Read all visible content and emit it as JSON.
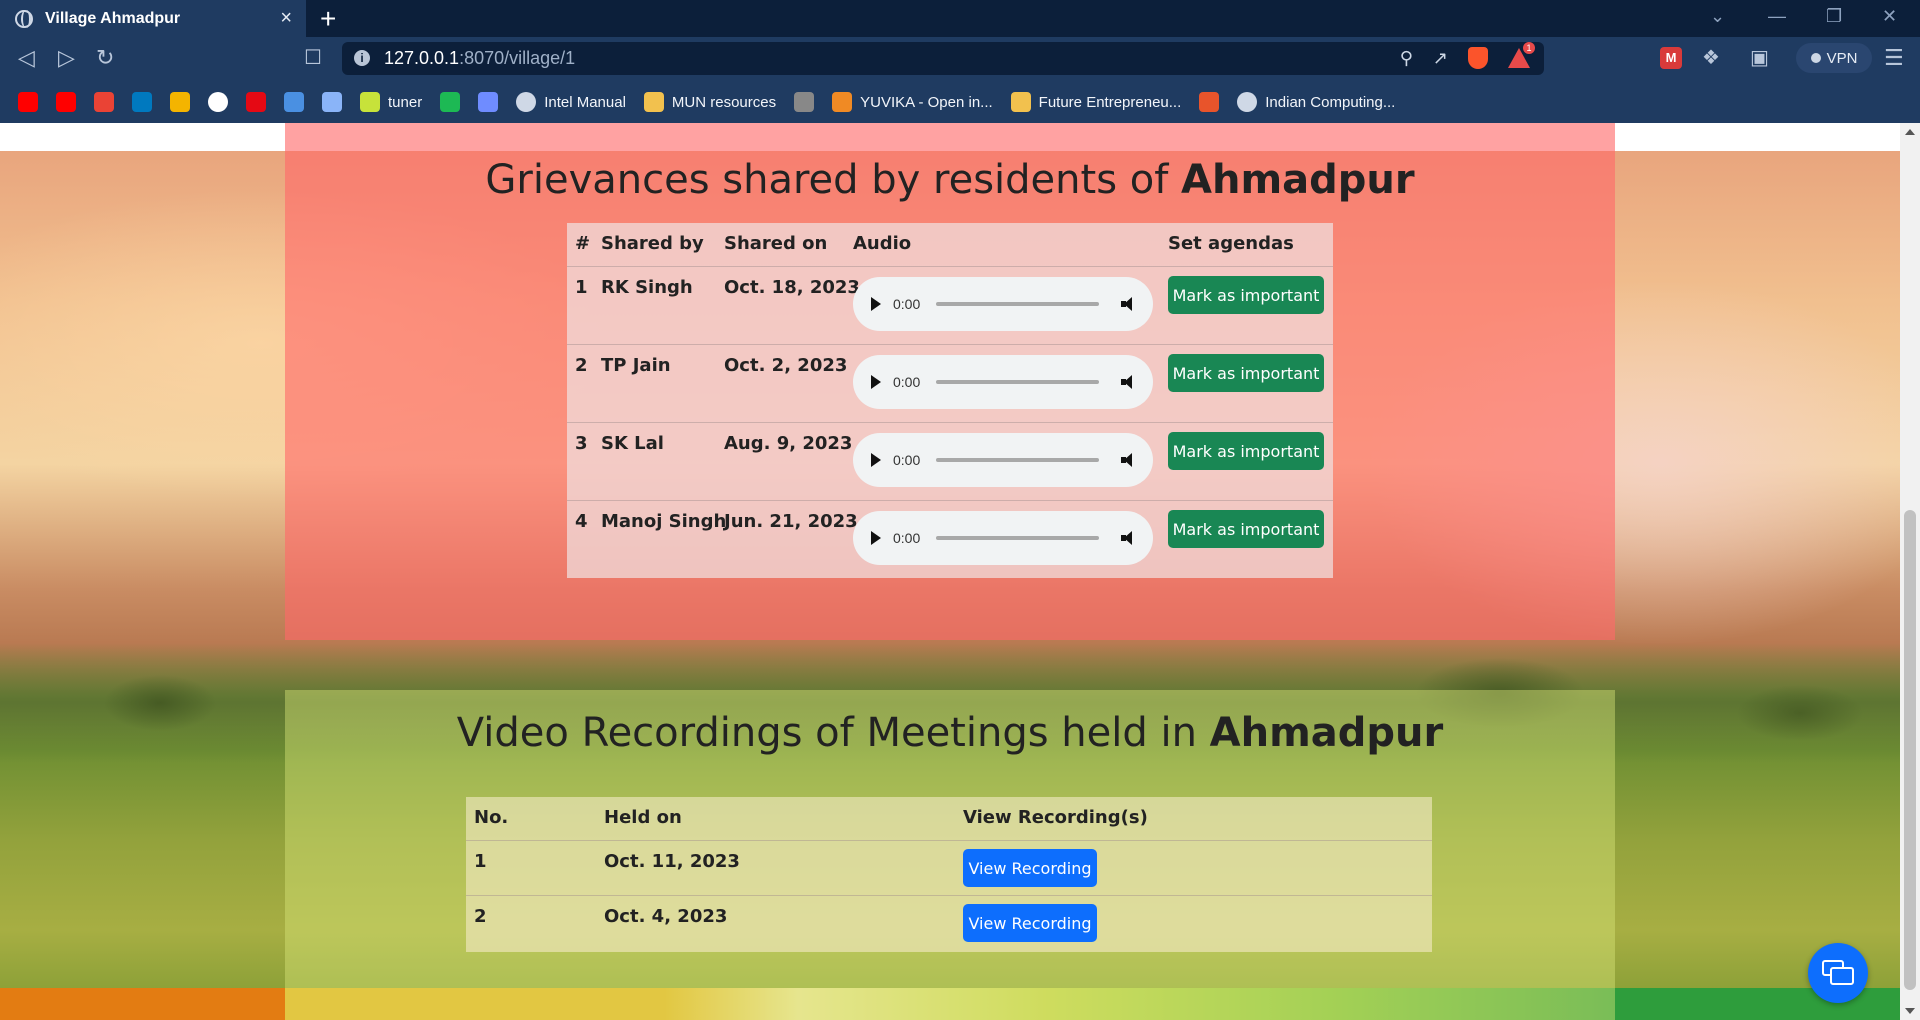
{
  "browser": {
    "tab_title": "Village Ahmadpur",
    "tab_close": "×",
    "new_tab": "+",
    "url_host": "127.0.0.1",
    "url_path": ":8070/village/1",
    "brave_badge": "1",
    "vpn_label": "VPN",
    "bookmarks": [
      {
        "label": "",
        "icon": "youtube-icon",
        "color": "#ff0000"
      },
      {
        "label": "",
        "icon": "youtube-music-icon",
        "color": "#ff0000"
      },
      {
        "label": "",
        "icon": "gmail-icon",
        "color": "#ea4335"
      },
      {
        "label": "",
        "icon": "trello-icon",
        "color": "#0079bf"
      },
      {
        "label": "",
        "icon": "photos-icon",
        "color": "#f4b400"
      },
      {
        "label": "",
        "icon": "github-icon",
        "color": "#ffffff"
      },
      {
        "label": "",
        "icon": "netflix-icon",
        "color": "#e50914"
      },
      {
        "label": "",
        "icon": "course-icon",
        "color": "#4a90e2"
      },
      {
        "label": "",
        "icon": "sparkle-icon",
        "color": "#8ab4f8"
      },
      {
        "label": "tuner",
        "icon": "tuner-icon",
        "color": "#c7e23a"
      },
      {
        "label": "",
        "icon": "spotify-icon",
        "color": "#1db954"
      },
      {
        "label": "",
        "icon": "calendar-icon",
        "color": "#6f8cff"
      },
      {
        "label": "Intel Manual",
        "icon": "globe-icon",
        "color": "#cfd8e6"
      },
      {
        "label": "MUN resources",
        "icon": "folder-icon",
        "color": "#f2c14e"
      },
      {
        "label": "",
        "icon": "dots-icon",
        "color": "#888888"
      },
      {
        "label": "YUVIKA - Open in...",
        "icon": "isro-icon",
        "color": "#f08a24"
      },
      {
        "label": "Future Entrepreneu...",
        "icon": "bird-icon",
        "color": "#f2c14e"
      },
      {
        "label": "",
        "icon": "flame-icon",
        "color": "#e8542b"
      },
      {
        "label": "Indian Computing...",
        "icon": "globe-icon",
        "color": "#cfd8e6"
      }
    ]
  },
  "grievances": {
    "title_prefix": "Grievances shared by residents of ",
    "village": "Ahmadpur",
    "headers": {
      "num": "#",
      "shared_by": "Shared by",
      "shared_on": "Shared on",
      "audio": "Audio",
      "agenda": "Set agendas"
    },
    "rows": [
      {
        "num": "1",
        "shared_by": "RK Singh",
        "shared_on": "Oct. 18, 2023",
        "time": "0:00",
        "action": "Mark as important"
      },
      {
        "num": "2",
        "shared_by": "TP Jain",
        "shared_on": "Oct. 2, 2023",
        "time": "0:00",
        "action": "Mark as important"
      },
      {
        "num": "3",
        "shared_by": "SK Lal",
        "shared_on": "Aug. 9, 2023",
        "time": "0:00",
        "action": "Mark as important"
      },
      {
        "num": "4",
        "shared_by": "Manoj Singh",
        "shared_on": "Jun. 21, 2023",
        "time": "0:00",
        "action": "Mark as important"
      }
    ]
  },
  "meetings": {
    "title_prefix": "Video Recordings of Meetings held in ",
    "village": "Ahmadpur",
    "headers": {
      "no": "No.",
      "held_on": "Held on",
      "view": "View Recording(s)"
    },
    "rows": [
      {
        "no": "1",
        "held_on": "Oct. 11, 2023",
        "action": "View Recording"
      },
      {
        "no": "2",
        "held_on": "Oct. 4, 2023",
        "action": "View Recording"
      }
    ]
  },
  "colors": {
    "success": "#198754",
    "primary": "#0d6efd",
    "grievance_panel": "#ff6969",
    "chrome": "#1f3b61"
  }
}
